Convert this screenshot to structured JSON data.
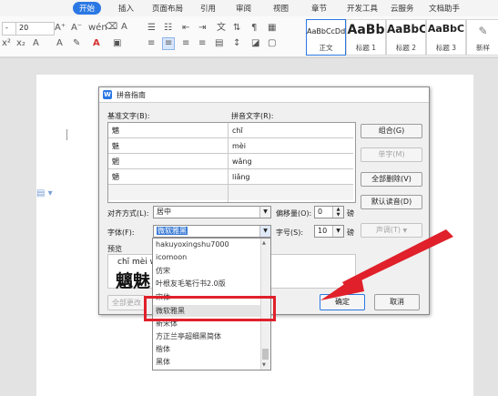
{
  "ribbon": {
    "tabs": [
      "开始",
      "插入",
      "页面布局",
      "引用",
      "审阅",
      "视图",
      "章节",
      "开发工具",
      "云服务",
      "文档助手"
    ],
    "font_size": "20",
    "styles": [
      {
        "sample": "AaBbCcDd",
        "name": "正文"
      },
      {
        "sample": "AaBb",
        "name": "标题 1"
      },
      {
        "sample": "AaBbC",
        "name": "标题 2"
      },
      {
        "sample": "AaBbC",
        "name": "标题 3"
      },
      {
        "sample": "",
        "name": "新样"
      }
    ]
  },
  "dialog": {
    "title": "拼音指南",
    "base_text_label": "基准文字(B):",
    "ruby_text_label": "拼音文字(R):",
    "rows": [
      {
        "base": "魑",
        "ruby": "chī"
      },
      {
        "base": "魅",
        "ruby": "mèi"
      },
      {
        "base": "魍",
        "ruby": "wǎng"
      },
      {
        "base": "魉",
        "ruby": "liǎng"
      }
    ],
    "buttons": {
      "group": "组合(G)",
      "mono": "单字(M)",
      "clear_all": "全部删除(V)",
      "default_reading": "默认读音(D)",
      "tone": "声调(T)",
      "apply_all": "全部更改",
      "ok": "确定",
      "cancel": "取消"
    },
    "alignment_label": "对齐方式(L):",
    "alignment_value": "居中",
    "offset_label": "偏移量(O):",
    "offset_value": "0",
    "offset_unit": "磅",
    "font_label": "字体(F):",
    "font_value": "微软雅黑",
    "size_label": "字号(S):",
    "size_value": "10",
    "size_unit": "磅",
    "preview_label": "预览",
    "preview_ruby": "chī mèi w",
    "preview_base": "魑魅",
    "font_list": [
      "hakuyoxingshu7000",
      "icomoon",
      "仿宋",
      "叶根友毛笔行书2.0版",
      "宋体",
      "微软雅黑",
      "新宋体",
      "方正兰亭超细黑简体",
      "楷体",
      "黑体"
    ],
    "font_list_selected": "微软雅黑"
  },
  "colors": {
    "accent": "#2b78e4",
    "highlight": "#e0202a"
  }
}
